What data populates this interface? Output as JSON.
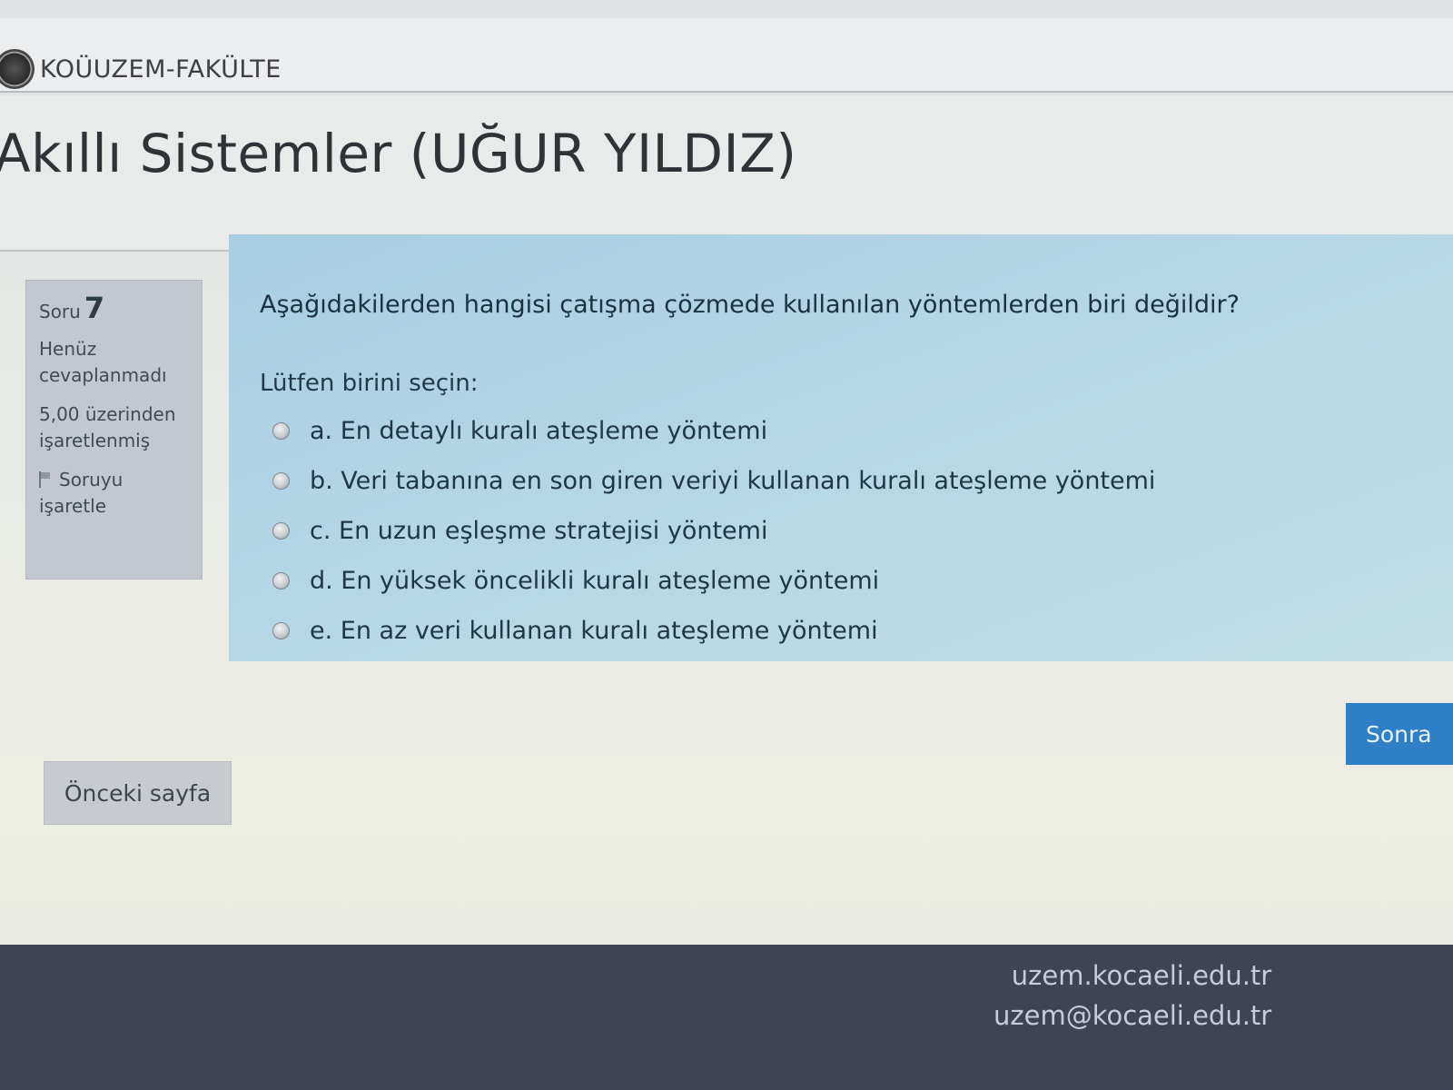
{
  "brand": {
    "name": "KOÜUZEM-FAKÜLTE"
  },
  "course": {
    "title": "Akıllı Sistemler (UĞUR YILDIZ)"
  },
  "question_info": {
    "label": "Soru",
    "number": "7",
    "state": "Henüz cevaplanmadı",
    "grade": "5,00 üzerinden işaretlenmiş",
    "flag_label": "Soruyu işaretle"
  },
  "question": {
    "text": "Aşağıdakilerden hangisi çatışma çözmede kullanılan yöntemlerden biri değildir?",
    "prompt": "Lütfen birini seçin:",
    "answers": [
      "a. En detaylı kuralı ateşleme yöntemi",
      "b. Veri tabanına en son giren veriyi kullanan kuralı ateşleme yöntemi",
      "c. En uzun eşleşme stratejisi yöntemi",
      "d. En yüksek öncelikli kuralı ateşleme yöntemi",
      "e. En az veri kullanan kuralı ateşleme yöntemi"
    ]
  },
  "navigation": {
    "prev_label": "Önceki sayfa",
    "next_label": "Sonra"
  },
  "footer": {
    "website": "uzem.kocaeli.edu.tr",
    "email": "uzem@kocaeli.edu.tr"
  },
  "colors": {
    "content_bg": "#b5d6e6",
    "info_bg": "#c3c8d0",
    "next_button": "#2f7fc7",
    "footer_bg": "#3f4352"
  },
  "icons": {
    "logo": "university-seal-icon",
    "flag": "flag-icon",
    "radio": "radio-icon"
  }
}
